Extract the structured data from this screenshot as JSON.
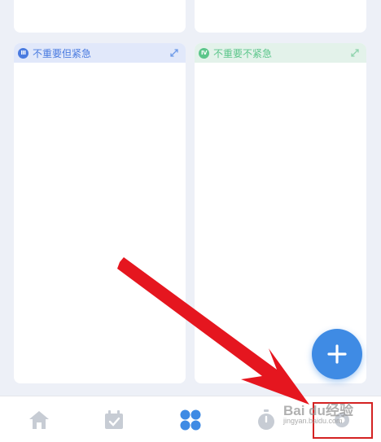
{
  "quadrants": {
    "q3": {
      "numeral": "III",
      "title": "不重要但紧急",
      "color": "#4a7be0"
    },
    "q4": {
      "numeral": "IV",
      "title": "不重要不紧急",
      "color": "#5cc68b"
    }
  },
  "fab": {
    "icon": "plus-icon",
    "symbol": "+"
  },
  "tabbar": {
    "items": [
      {
        "icon": "home-icon",
        "active": false
      },
      {
        "icon": "calendar-check-icon",
        "active": false
      },
      {
        "icon": "four-quadrant-icon",
        "active": true
      },
      {
        "icon": "stopwatch-icon",
        "active": false
      },
      {
        "icon": "gear-icon",
        "active": false
      }
    ],
    "active_color": "#3f8be4",
    "inactive_color": "#c7ccd4"
  },
  "annotation": {
    "arrow_color": "#e5161f",
    "box_color": "#d42222"
  },
  "watermark": {
    "text": "Bai du经验",
    "sub": "jingyan.baidu.com"
  }
}
